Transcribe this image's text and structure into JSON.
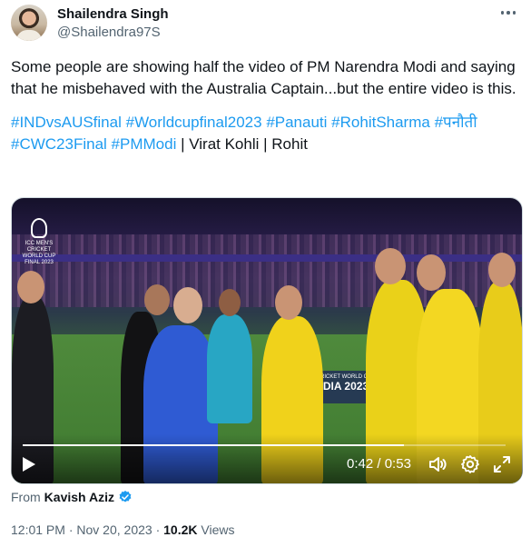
{
  "author": {
    "name": "Shailendra Singh",
    "handle": "@Shailendra97S"
  },
  "tweet": {
    "text": "Some people are showing half the video of PM Narendra Modi and saying that he misbehaved with the Australia Captain...but the entire video is this.",
    "hashtags": [
      "#INDvsAUSfinal",
      "#Worldcupfinal2023",
      "#Panauti",
      "#RohitSharma",
      "#पनौती",
      "#CWC23Final",
      "#PMModi"
    ],
    "tail_text": " | Virat Kohli | Rohit"
  },
  "video": {
    "current_time": "0:42",
    "separator": "/",
    "duration": "0:53",
    "progress": 0.79,
    "logo_lines": [
      "ICC MEN'S",
      "CRICKET",
      "WORLD CUP",
      "FINAL 2023"
    ],
    "board_small": "CRICKET WORLD CUP",
    "board_big": "DIA 2023",
    "icons": {
      "play": "play-icon",
      "volume": "volume-icon",
      "settings": "settings-icon",
      "fullscreen": "fullscreen-icon"
    }
  },
  "source": {
    "prefix": "From",
    "name": "Kavish Aziz",
    "verified": true
  },
  "meta": {
    "time": "12:01 PM",
    "dot1": "·",
    "date": "Nov 20, 2023",
    "dot2": "·",
    "views_count": "10.2K",
    "views_label": "Views"
  },
  "colors": {
    "link": "#1d9bf0",
    "text": "#0f1419",
    "secondary": "#536471",
    "verified": "#1d9bf0"
  }
}
